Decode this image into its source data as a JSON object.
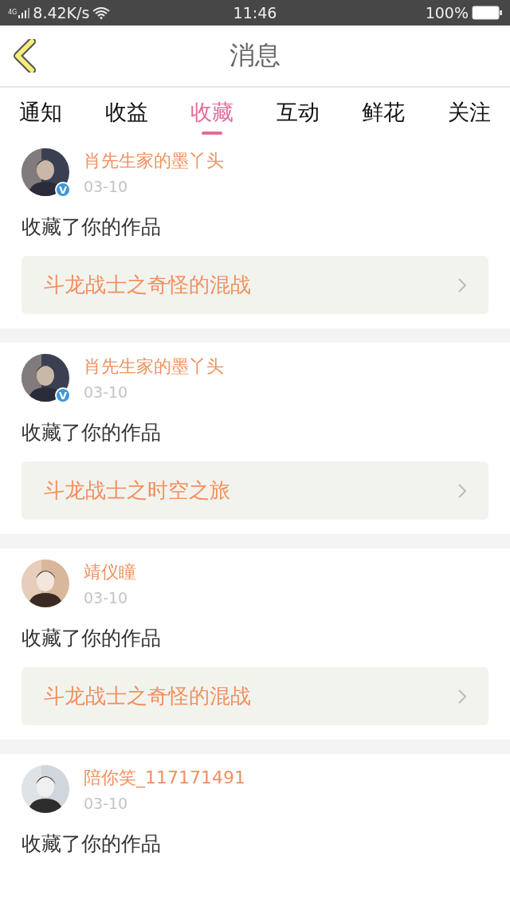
{
  "status_bar": {
    "network": "4G",
    "speed": "8.42K/s",
    "time": "11:46",
    "battery": "100%"
  },
  "header": {
    "title": "消息"
  },
  "tabs": [
    {
      "label": "通知",
      "selected": false
    },
    {
      "label": "收益",
      "selected": false
    },
    {
      "label": "收藏",
      "selected": true
    },
    {
      "label": "互动",
      "selected": false
    },
    {
      "label": "鲜花",
      "selected": false
    },
    {
      "label": "关注",
      "selected": false
    }
  ],
  "messages": [
    {
      "user": "肖先生家的墨丫头",
      "badge": "V",
      "date": "03-10",
      "action": "收藏了你的作品",
      "work": "斗龙战士之奇怪的混战"
    },
    {
      "user": "肖先生家的墨丫头",
      "badge": "V",
      "date": "03-10",
      "action": "收藏了你的作品",
      "work": "斗龙战士之时空之旅"
    },
    {
      "user": "靖仪瞳",
      "date": "03-10",
      "action": "收藏了你的作品",
      "work": "斗龙战士之奇怪的混战"
    },
    {
      "user": "陪你笑_117171491",
      "date": "03-10",
      "action": "收藏了你的作品"
    }
  ]
}
